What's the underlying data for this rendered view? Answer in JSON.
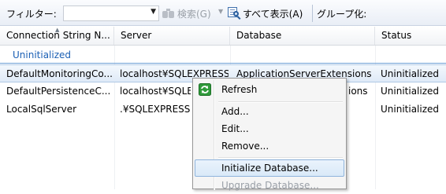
{
  "toolbar": {
    "filter_label": "フィルター:",
    "filter_value": "",
    "search_label": "検索(G)",
    "show_all_label": "すべて表示(A)",
    "group_by_label": "グループ化:"
  },
  "grid": {
    "columns": [
      "Connection String N...",
      "Server",
      "Database",
      "Status"
    ],
    "sorted_column": "Connection String N...",
    "group_label": "Uninitialized",
    "rows": [
      {
        "name": "DefaultMonitoringCo...",
        "server": "localhost¥SQLEXPRESS",
        "database": "ApplicationServerExtensions",
        "status": "Uninitialized",
        "selected": true
      },
      {
        "name": "DefaultPersistenceC...",
        "server": "localhost¥SQLEX",
        "database": "ions",
        "status": "Uninitialized",
        "selected": false
      },
      {
        "name": "LocalSqlServer",
        "server": ".¥SQLEXPRESS",
        "database": "",
        "status": "Uninitialized",
        "selected": false
      }
    ]
  },
  "context_menu": {
    "refresh": "Refresh",
    "add": "Add...",
    "edit": "Edit...",
    "remove": "Remove...",
    "initialize_database": "Initialize Database...",
    "upgrade_database": "Upgrade Database..."
  },
  "colors": {
    "selection_bg": "#dfeaf7",
    "group_text": "#1a5fb4",
    "menu_hover_border": "#8fb4dc"
  }
}
